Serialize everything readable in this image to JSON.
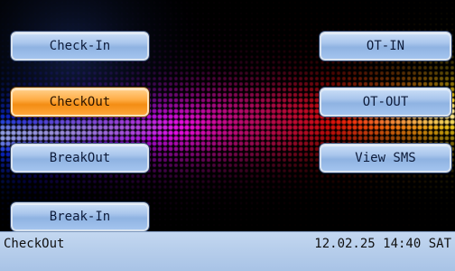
{
  "buttons": {
    "check_in": "Check-In",
    "checkout": "CheckOut",
    "breakout": "BreakOut",
    "break_in": "Break-In",
    "ot_in": "OT-IN",
    "ot_out": "OT-OUT",
    "view_sms": "View SMS"
  },
  "selected_button": "checkout",
  "status_bar": {
    "mode": "CheckOut",
    "datetime": "12.02.25 14:40 SAT"
  },
  "colors": {
    "button_normal": "#a9c6ec",
    "button_selected": "#f38d14",
    "status_bar": "#b5cdeb"
  }
}
